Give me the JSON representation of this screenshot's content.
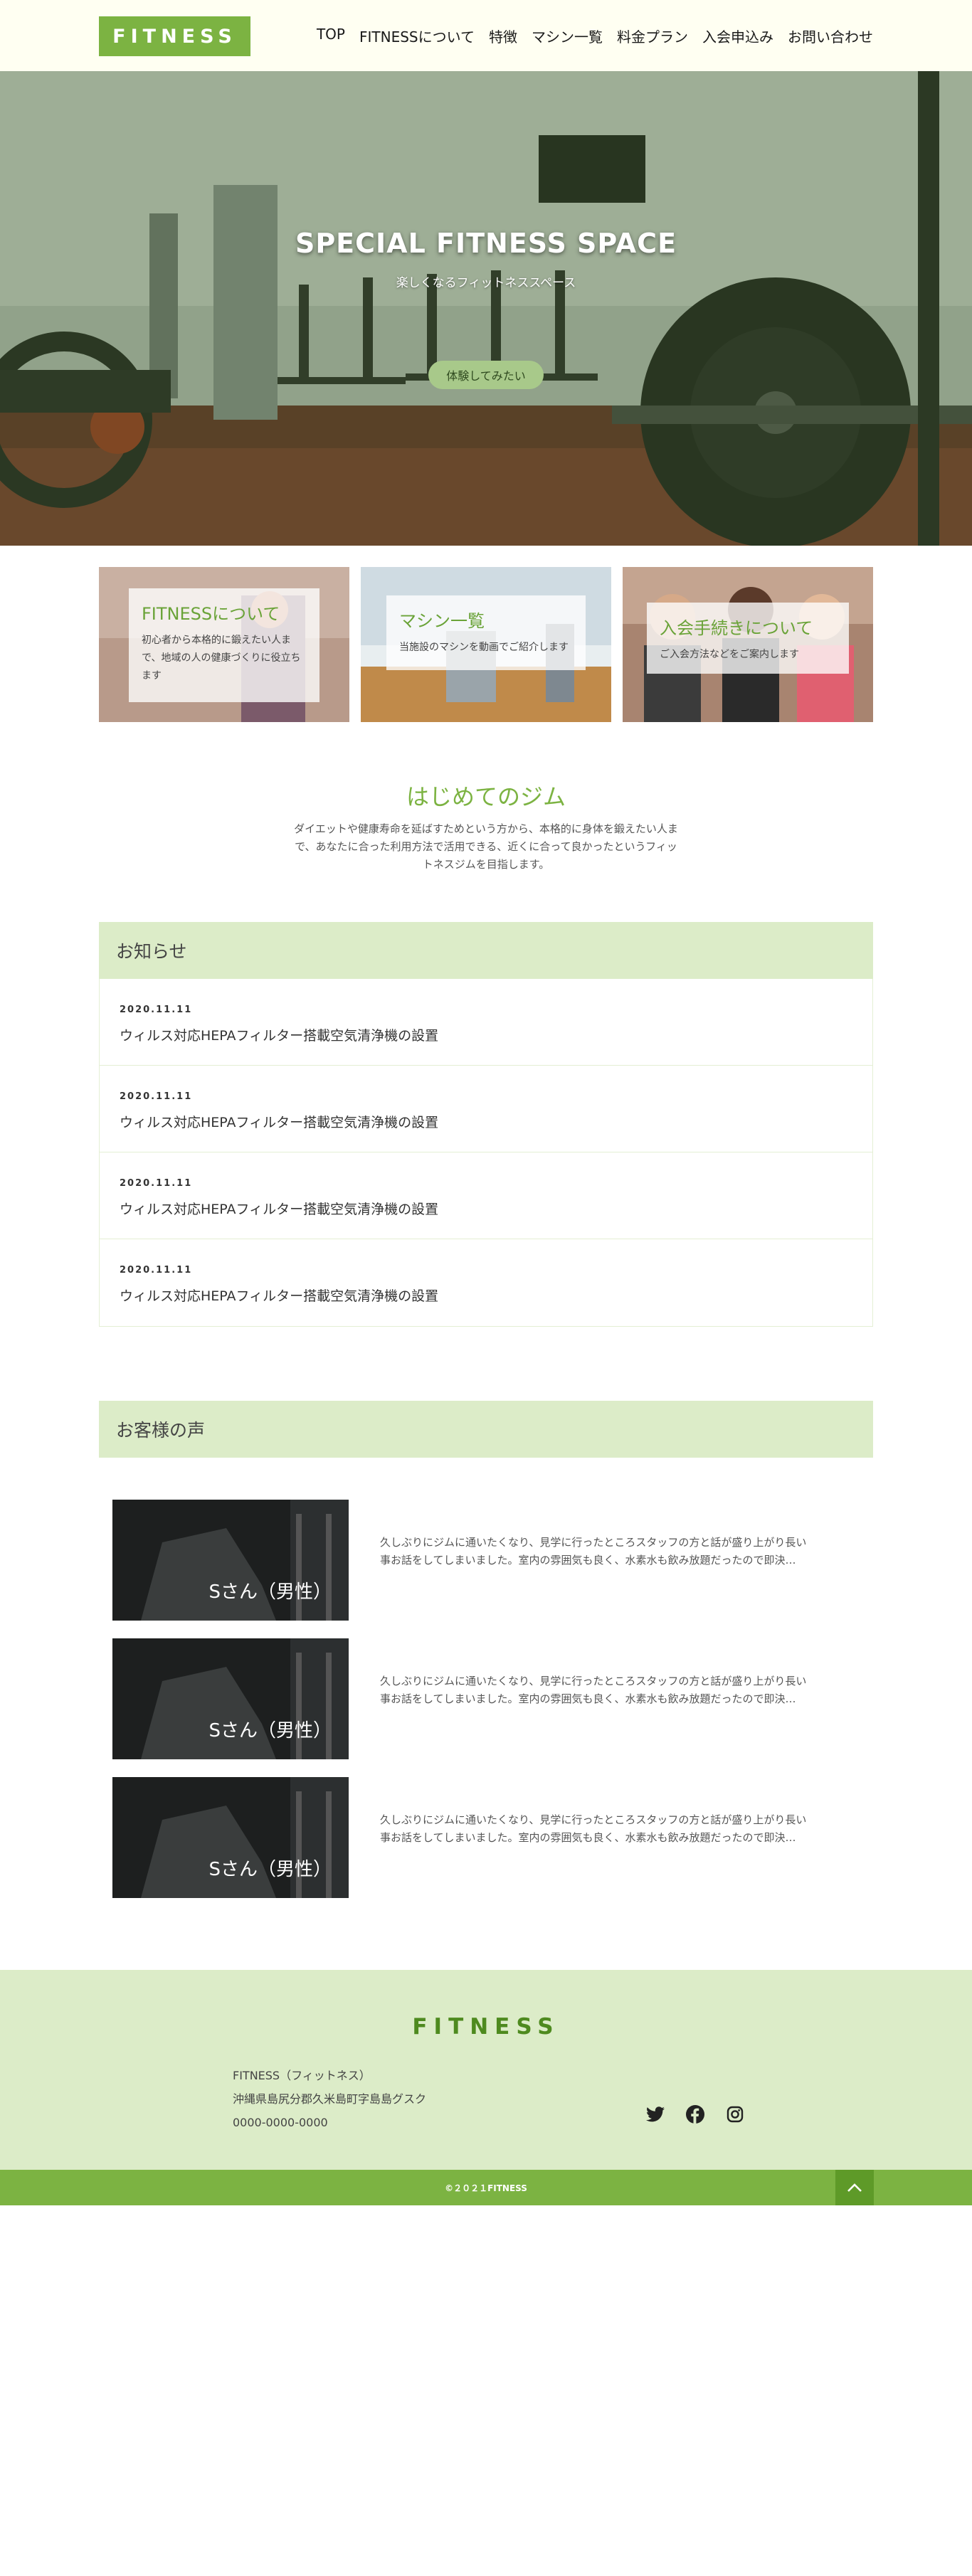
{
  "header": {
    "logo": "FITNESS",
    "nav": [
      "TOP",
      "FITNESSについて",
      "特徴",
      "マシン一覧",
      "料金プラン",
      "入会申込み",
      "お問い合わせ"
    ]
  },
  "hero": {
    "title": "SPECIAL FITNESS SPACE",
    "subtitle": "楽しくなるフィットネススペース",
    "button": "体験してみたい"
  },
  "cards": [
    {
      "title": "FITNESSについて",
      "text": "初心者から本格的に鍛えたい人まで、地域の人の健康づくりに役立ちます"
    },
    {
      "title": "マシン一覧",
      "text": "当施設のマシンを動画でご紹介します"
    },
    {
      "title": "入会手続きについて",
      "text": "ご入会方法などをご案内します"
    }
  ],
  "intro": {
    "title": "はじめてのジム",
    "text": "ダイエットや健康寿命を延ばすためという方から、本格的に身体を鍛えたい人まで、あなたに合った利用方法で活用できる、近くに合って良かったというフィットネスジムを目指します。"
  },
  "news": {
    "heading": "お知らせ",
    "items": [
      {
        "date": "2020.11.11",
        "title": "ウィルス対応HEPAフィルター搭載空気清浄機の設置"
      },
      {
        "date": "2020.11.11",
        "title": "ウィルス対応HEPAフィルター搭載空気清浄機の設置"
      },
      {
        "date": "2020.11.11",
        "title": "ウィルス対応HEPAフィルター搭載空気清浄機の設置"
      },
      {
        "date": "2020.11.11",
        "title": "ウィルス対応HEPAフィルター搭載空気清浄機の設置"
      }
    ]
  },
  "voices": {
    "heading": "お客様の声",
    "items": [
      {
        "name": "Sさん（男性）",
        "text": "久しぶりにジムに通いたくなり、見学に行ったところスタッフの方と話が盛り上がり長い事お話をしてしまいました。室内の雰囲気も良く、水素水も飲み放題だったので即決…"
      },
      {
        "name": "Sさん（男性）",
        "text": "久しぶりにジムに通いたくなり、見学に行ったところスタッフの方と話が盛り上がり長い事お話をしてしまいました。室内の雰囲気も良く、水素水も飲み放題だったので即決…"
      },
      {
        "name": "Sさん（男性）",
        "text": "久しぶりにジムに通いたくなり、見学に行ったところスタッフの方と話が盛り上がり長い事お話をしてしまいました。室内の雰囲気も良く、水素水も飲み放題だったので即決…"
      }
    ]
  },
  "footer": {
    "logo": "FITNESS",
    "name": "FITNESS（フィットネス）",
    "address": "沖縄県島尻分郡久米島町字島島グスク",
    "phone": "0000-0000-0000",
    "social_icons": [
      "twitter-icon",
      "facebook-icon",
      "instagram-icon"
    ],
    "copyright": "©２０２１FITNESS"
  },
  "colors": {
    "accent": "#7cb342",
    "light": "#dcecc8",
    "header_bg": "#fffff2"
  }
}
